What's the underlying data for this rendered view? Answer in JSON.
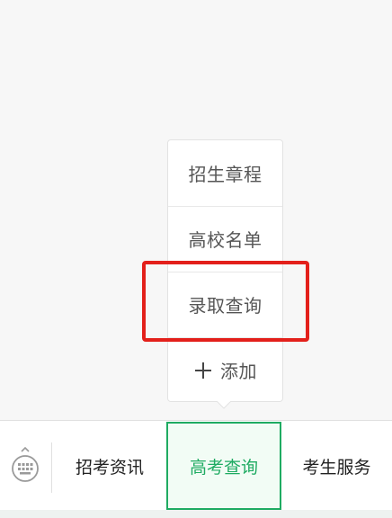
{
  "submenu": {
    "items": [
      {
        "label": "招生章程"
      },
      {
        "label": "高校名单"
      },
      {
        "label": "录取查询"
      }
    ],
    "add_label": "添加"
  },
  "bottom_menu": {
    "tabs": [
      {
        "label": "招考资讯"
      },
      {
        "label": "高考查询"
      },
      {
        "label": "考生服务"
      }
    ]
  },
  "colors": {
    "active_tab": "#1fab62",
    "highlight": "#e3201b"
  }
}
